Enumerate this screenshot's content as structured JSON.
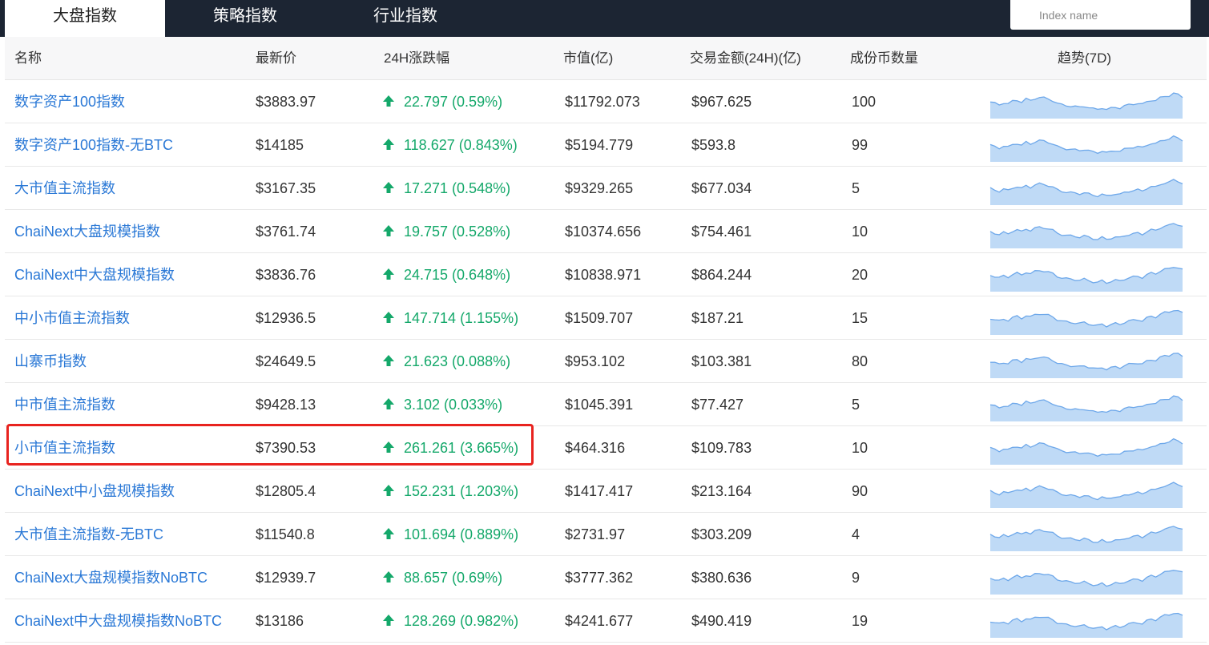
{
  "tabs": [
    {
      "label": "大盘指数",
      "active": true
    },
    {
      "label": "策略指数",
      "active": false
    },
    {
      "label": "行业指数",
      "active": false
    }
  ],
  "search": {
    "placeholder": "Index name",
    "value": ""
  },
  "columns": [
    "名称",
    "最新价",
    "24H涨跌幅",
    "市值(亿)",
    "交易金额(24H)(亿)",
    "成份币数量",
    "趋势(7D)"
  ],
  "colors": {
    "accent": "#2a78d6",
    "up": "#14a86a",
    "header_bg": "#1c2533",
    "highlight": "#e8231f",
    "spark_fill": "#a9cdf3",
    "spark_line": "#6ea8ea"
  },
  "rows": [
    {
      "name": "数字资产100指数",
      "price": "$3883.97",
      "change": "22.797 (0.59%)",
      "cap": "$11792.073",
      "volume": "$967.625",
      "count": "100",
      "highlighted": false
    },
    {
      "name": "数字资产100指数-无BTC",
      "price": "$14185",
      "change": "118.627 (0.843%)",
      "cap": "$5194.779",
      "volume": "$593.8",
      "count": "99",
      "highlighted": false
    },
    {
      "name": "大市值主流指数",
      "price": "$3167.35",
      "change": "17.271 (0.548%)",
      "cap": "$9329.265",
      "volume": "$677.034",
      "count": "5",
      "highlighted": false
    },
    {
      "name": "ChaiNext大盘规模指数",
      "price": "$3761.74",
      "change": "19.757 (0.528%)",
      "cap": "$10374.656",
      "volume": "$754.461",
      "count": "10",
      "highlighted": false
    },
    {
      "name": "ChaiNext中大盘规模指数",
      "price": "$3836.76",
      "change": "24.715 (0.648%)",
      "cap": "$10838.971",
      "volume": "$864.244",
      "count": "20",
      "highlighted": false
    },
    {
      "name": "中小市值主流指数",
      "price": "$12936.5",
      "change": "147.714 (1.155%)",
      "cap": "$1509.707",
      "volume": "$187.21",
      "count": "15",
      "highlighted": false
    },
    {
      "name": "山寨币指数",
      "price": "$24649.5",
      "change": "21.623 (0.088%)",
      "cap": "$953.102",
      "volume": "$103.381",
      "count": "80",
      "highlighted": false
    },
    {
      "name": "中市值主流指数",
      "price": "$9428.13",
      "change": "3.102 (0.033%)",
      "cap": "$1045.391",
      "volume": "$77.427",
      "count": "5",
      "highlighted": false
    },
    {
      "name": "小市值主流指数",
      "price": "$7390.53",
      "change": "261.261 (3.665%)",
      "cap": "$464.316",
      "volume": "$109.783",
      "count": "10",
      "highlighted": true
    },
    {
      "name": "ChaiNext中小盘规模指数",
      "price": "$12805.4",
      "change": "152.231 (1.203%)",
      "cap": "$1417.417",
      "volume": "$213.164",
      "count": "90",
      "highlighted": false
    },
    {
      "name": "大市值主流指数-无BTC",
      "price": "$11540.8",
      "change": "101.694 (0.889%)",
      "cap": "$2731.97",
      "volume": "$303.209",
      "count": "4",
      "highlighted": false
    },
    {
      "name": "ChaiNext大盘规模指数NoBTC",
      "price": "$12939.7",
      "change": "88.657 (0.69%)",
      "cap": "$3777.362",
      "volume": "$380.636",
      "count": "9",
      "highlighted": false
    },
    {
      "name": "ChaiNext中大盘规模指数NoBTC",
      "price": "$13186",
      "change": "128.269 (0.982%)",
      "cap": "$4241.677",
      "volume": "$490.419",
      "count": "19",
      "highlighted": false
    }
  ],
  "trend": [
    0.55,
    0.5,
    0.45,
    0.52,
    0.48,
    0.58,
    0.62,
    0.55,
    0.66,
    0.6,
    0.68,
    0.72,
    0.7,
    0.66,
    0.6,
    0.5,
    0.45,
    0.42,
    0.4,
    0.38,
    0.36,
    0.4,
    0.35,
    0.3,
    0.28,
    0.34,
    0.27,
    0.32,
    0.36,
    0.33,
    0.4,
    0.45,
    0.48,
    0.5,
    0.46,
    0.56,
    0.62,
    0.6,
    0.7,
    0.76,
    0.78,
    0.86,
    0.82,
    0.74
  ]
}
